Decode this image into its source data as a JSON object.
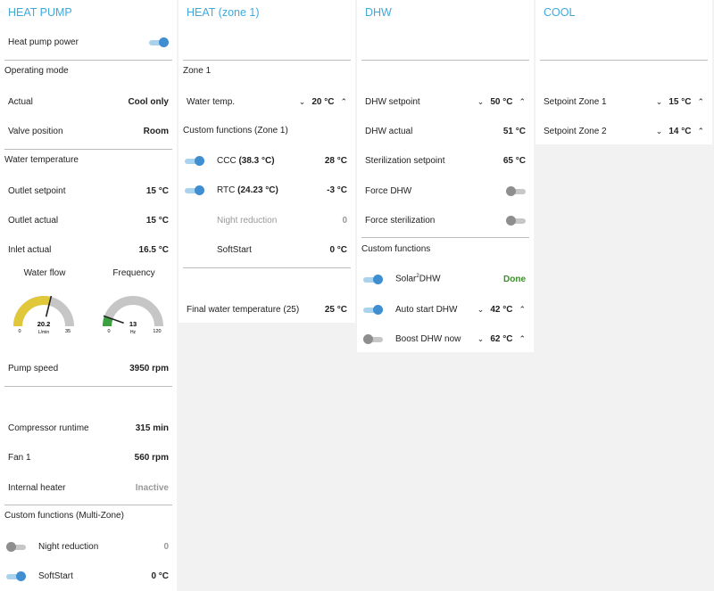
{
  "colors": {
    "accent": "#3fa9dc",
    "toggle_on": "#3f8ed0",
    "toggle_off": "#8e8e8e",
    "done": "#3a8f2a",
    "gauge_flow": "#e0c83a",
    "gauge_freq": "#3aa040",
    "gauge_bg": "#c6c6c6"
  },
  "heat_pump": {
    "title": "HEAT PUMP",
    "power_label": "Heat pump power",
    "power_on": true,
    "operating_mode": {
      "header": "Operating mode",
      "actual_label": "Actual",
      "actual_value": "Cool only",
      "valve_label": "Valve position",
      "valve_value": "Room"
    },
    "water_temperature": {
      "header": "Water temperature",
      "outlet_setpoint_label": "Outlet setpoint",
      "outlet_setpoint_value": "15 °C",
      "outlet_actual_label": "Outlet actual",
      "outlet_actual_value": "15 °C",
      "inlet_actual_label": "Inlet actual",
      "inlet_actual_value": "16.5 °C"
    },
    "water_flow_gauge": {
      "label": "Water flow",
      "value": 20.2,
      "value_text": "20.2",
      "unit": "L/min",
      "min": 0,
      "max": 35,
      "min_text": "0",
      "max_text": "35"
    },
    "frequency_gauge": {
      "label": "Frequency",
      "value": 13,
      "value_text": "13",
      "unit": "Hz",
      "min": 0,
      "max": 120,
      "min_text": "0",
      "max_text": "120"
    },
    "pump_speed_label": "Pump speed",
    "pump_speed_value": "3950 rpm",
    "compressor_runtime_label": "Compressor runtime",
    "compressor_runtime_value": "315 min",
    "fan_label": "Fan 1",
    "fan_value": "560 rpm",
    "internal_heater_label": "Internal heater",
    "internal_heater_value": "Inactive",
    "custom_functions": {
      "header": "Custom functions (Multi-Zone)",
      "night_reduction_label": "Night reduction",
      "night_reduction_value": "0",
      "night_reduction_on": false,
      "softstart_label": "SoftStart",
      "softstart_value": "0 °C",
      "softstart_on": true
    }
  },
  "heat_zone1": {
    "title": "HEAT (zone 1)",
    "zone_header": "Zone 1",
    "water_temp_label": "Water temp.",
    "water_temp_value": "20 °C",
    "custom_header": "Custom functions (Zone 1)",
    "ccc_label": "CCC",
    "ccc_detail": "(38.3 °C)",
    "ccc_value": "28 °C",
    "ccc_on": true,
    "rtc_label": "RTC",
    "rtc_detail": "(24.23 °C)",
    "rtc_value": "-3 °C",
    "rtc_on": true,
    "night_reduction_label": "Night reduction",
    "night_reduction_value": "0",
    "softstart_label": "SoftStart",
    "softstart_value": "0 °C",
    "final_water_label": "Final water temperature (25)",
    "final_water_value": "25 °C"
  },
  "dhw": {
    "title": "DHW",
    "setpoint_label": "DHW setpoint",
    "setpoint_value": "50 °C",
    "actual_label": "DHW actual",
    "actual_value": "51 °C",
    "sterilization_setpoint_label": "Sterilization setpoint",
    "sterilization_setpoint_value": "65 °C",
    "force_dhw_label": "Force DHW",
    "force_dhw_on": false,
    "force_sterilization_label": "Force sterilization",
    "force_sterilization_on": false,
    "custom_header": "Custom functions",
    "solar_label": "Solar",
    "solar_sup": "2",
    "solar_suffix": "DHW",
    "solar_value": "Done",
    "solar_on": true,
    "auto_start_label": "Auto start DHW",
    "auto_start_value": "42 °C",
    "auto_start_on": true,
    "boost_label": "Boost DHW now",
    "boost_value": "62 °C",
    "boost_on": false
  },
  "cool": {
    "title": "COOL",
    "zone1_label": "Setpoint Zone 1",
    "zone1_value": "15 °C",
    "zone2_label": "Setpoint Zone 2",
    "zone2_value": "14 °C"
  }
}
